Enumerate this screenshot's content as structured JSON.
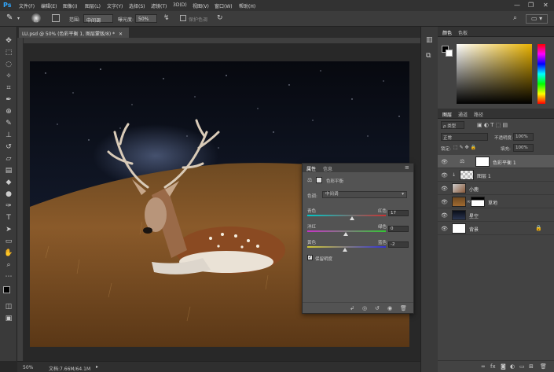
{
  "app": {
    "logo": "Ps"
  },
  "menu": [
    "文件(F)",
    "编辑(E)",
    "图像(I)",
    "图层(L)",
    "文字(Y)",
    "选择(S)",
    "滤镜(T)",
    "3D(D)",
    "视图(V)",
    "窗口(W)",
    "帮助(H)"
  ],
  "window_controls": {
    "minimize": "—",
    "restore": "❐",
    "close": "✕"
  },
  "options": {
    "brush_size": "65",
    "range_label": "范围:",
    "range_value": "中间调",
    "exposure_label": "曝光度:",
    "exposure_value": "50%",
    "protect_tones": "保护色调"
  },
  "document": {
    "tab_title": "LU.psd @ 50% (色彩平衡 1, 图层蒙版/8) *",
    "tab_close": "✕",
    "zoom": "50%",
    "doc_info": "文档:7.66M/64.1M"
  },
  "color_panel": {
    "tabs": [
      "颜色",
      "色板"
    ],
    "accent": "#e8b200"
  },
  "layers_panel": {
    "tabs": [
      "图层",
      "通道",
      "路径"
    ],
    "filter_label": "ρ 类型",
    "blend_mode": "正常",
    "opacity_label": "不透明度:",
    "opacity_value": "100%",
    "lock_label": "锁定:",
    "fill_label": "填充:",
    "fill_value": "100%",
    "layers": [
      {
        "name": "色彩平衡 1",
        "selected": true
      },
      {
        "name": "图层 1",
        "selected": false
      },
      {
        "name": "小鹿",
        "selected": false
      },
      {
        "name": "草地",
        "selected": false
      },
      {
        "name": "星空",
        "selected": false
      },
      {
        "name": "背景",
        "selected": false
      }
    ]
  },
  "properties": {
    "tabs": [
      "属性",
      "信息"
    ],
    "title": "色彩平衡",
    "tone_label": "色调:",
    "tone_value": "中间调",
    "sliders": [
      {
        "left": "青色",
        "right": "红色",
        "value": "17"
      },
      {
        "left": "洋红",
        "right": "绿色",
        "value": "0"
      },
      {
        "left": "黄色",
        "right": "蓝色",
        "value": "-2"
      }
    ],
    "preserve_luminosity": "保留明度"
  }
}
